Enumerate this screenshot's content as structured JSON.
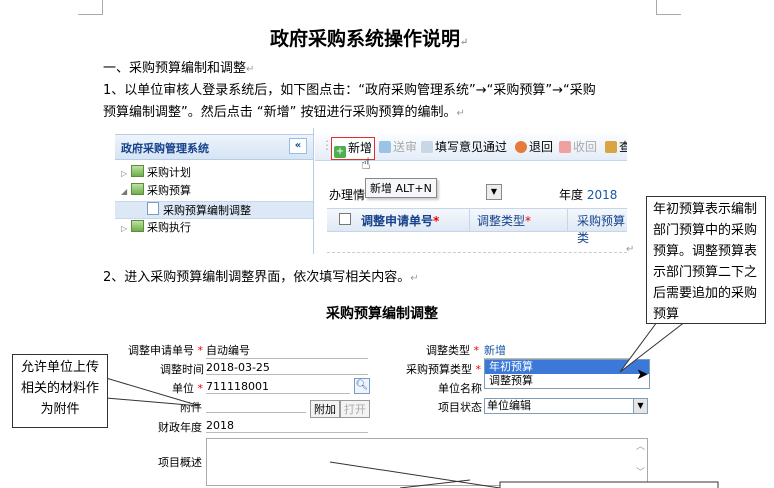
{
  "document": {
    "title": "政府采购系统操作说明",
    "section1_heading": "一、采购预算编制和调整",
    "step1_line1": "1、以单位审核人登录系统后，如下图点击：“政府采购管理系统”→“采购预算”→“采购",
    "step1_line2": "预算编制调整”。然后点击 “新增” 按钮进行采购预算的编制。",
    "step2_line": "2、进入采购预算编制调整界面，依次填写相关内容。",
    "return_mark": "↵"
  },
  "screenshot1": {
    "sidebar_title": "政府采购管理系统",
    "collapse_icon": "«",
    "tree": [
      {
        "label": "采购计划"
      },
      {
        "label": "采购预算"
      },
      {
        "label": "采购预算编制调整"
      },
      {
        "label": "采购执行"
      }
    ],
    "toolbar": {
      "new": "新增",
      "submit": "送审",
      "fill_opinion": "填写意见通过",
      "return": "退回",
      "recall": "收回",
      "trailing": "查"
    },
    "tooltip": "新增 ALT+N",
    "status_label": "办理情",
    "year_label": "年度",
    "year_value": "2018",
    "columns": [
      "调整申请单号",
      "调整类型",
      "采购预算类"
    ]
  },
  "callouts": {
    "right_note": "年初预算表示编制部门预算中的采购预算。调整预算表示部门预算二下之后需要追加的采购预算",
    "left_note": "允许单位上传相关的材料作为附件"
  },
  "form": {
    "title": "采购预算编制调整",
    "apply_no_label": "调整申请单号",
    "apply_no_value": "自动编号",
    "adjust_time_label": "调整时间",
    "adjust_time_value": "2018-03-25",
    "unit_label": "单位",
    "unit_value": "711118001",
    "attachment_label": "附件",
    "attach_button": "附加",
    "open_button": "打开",
    "fiscal_year_label": "财政年度",
    "fiscal_year_value": "2018",
    "overview_label": "项目概述",
    "adjust_type_label": "调整类型",
    "adjust_type_value": "新增",
    "budget_type_label": "采购预算类型",
    "budget_type_options": [
      "年初预算",
      "调整预算"
    ],
    "unit_name_label": "单位名称",
    "project_status_label": "项目状态",
    "project_status_value": "单位编辑"
  },
  "colors": {
    "required_mark": "#e00000",
    "link_blue": "#1a56a8",
    "highlight_border": "#e0302a",
    "selection_bg": "#3b78d8"
  }
}
